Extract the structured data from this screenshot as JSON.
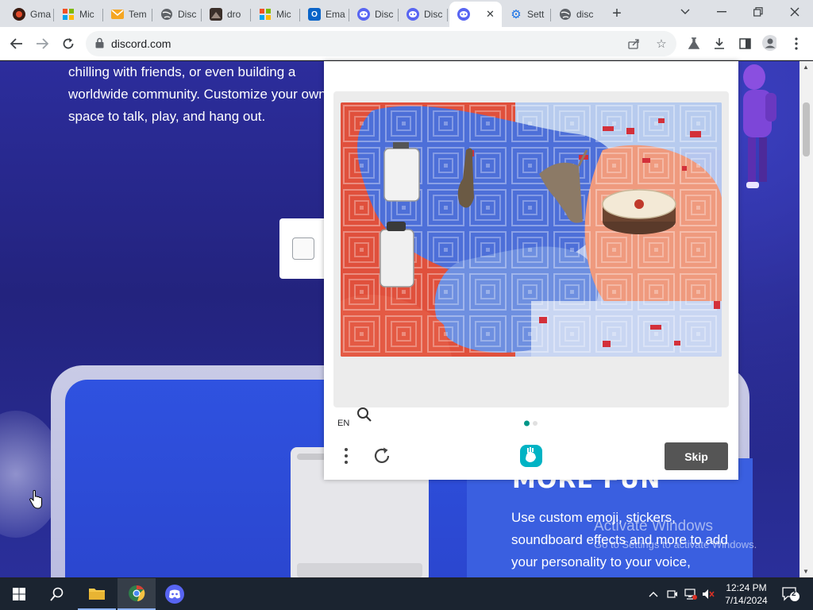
{
  "browser": {
    "tabs": [
      {
        "title": "Gma",
        "icon": "gmail-icon"
      },
      {
        "title": "Mic",
        "icon": "microsoft-icon"
      },
      {
        "title": "Tem",
        "icon": "mail-icon"
      },
      {
        "title": "Disc",
        "icon": "globe-icon"
      },
      {
        "title": "dro",
        "icon": "page-icon"
      },
      {
        "title": "Mic",
        "icon": "microsoft-icon"
      },
      {
        "title": "Ema",
        "icon": "outlook-icon"
      },
      {
        "title": "Disc",
        "icon": "discord-icon"
      },
      {
        "title": "Disc",
        "icon": "discord-icon"
      },
      {
        "title": "",
        "icon": "discord-icon",
        "active": true
      },
      {
        "title": "Sett",
        "icon": "settings-icon"
      },
      {
        "title": "disc",
        "icon": "globe-icon"
      }
    ],
    "url": "discord.com"
  },
  "page": {
    "hero_text": "chilling with friends, or even building a worldwide community. Customize your own space to talk, play, and hang out.",
    "fun_heading": "MORE FUN",
    "fun_text": "Use custom emoji, stickers, soundboard effects and more to add your personality to your voice,"
  },
  "captcha": {
    "language": "EN",
    "skip_label": "Skip",
    "progress": {
      "current": 1,
      "total": 2
    }
  },
  "watermark": {
    "line1": "Activate Windows",
    "line2": "Go to Settings to activate Windows."
  },
  "taskbar": {
    "time": "12:24 PM",
    "date": "7/14/2024",
    "notifications": "2"
  },
  "colors": {
    "accent": "#5865f2",
    "page_bg": "#23237e",
    "captcha_dot": "#009688",
    "skip_bg": "#555555"
  }
}
